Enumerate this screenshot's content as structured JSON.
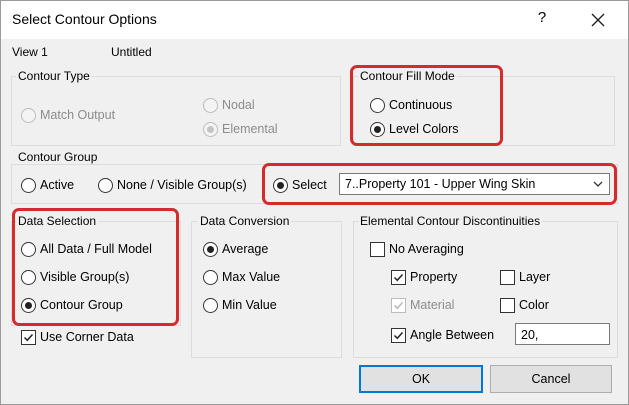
{
  "window": {
    "title": "Select Contour Options",
    "help_glyph": "?",
    "close_icon": "close-icon"
  },
  "view": {
    "name": "View 1",
    "title": "Untitled"
  },
  "contour_type": {
    "label": "Contour Type",
    "options": [
      "Match Output",
      "Nodal",
      "Elemental"
    ]
  },
  "contour_fill_mode": {
    "label": "Contour Fill Mode",
    "options": [
      "Continuous",
      "Level Colors"
    ],
    "selected": "Level Colors"
  },
  "contour_group": {
    "label": "Contour Group",
    "options": [
      "Active",
      "None / Visible Group(s)",
      "Select"
    ],
    "selected": "Select",
    "dropdown_value": "7..Property 101 - Upper Wing Skin"
  },
  "data_selection": {
    "label": "Data Selection",
    "options": [
      "All Data / Full Model",
      "Visible Group(s)",
      "Contour Group"
    ],
    "selected": "Contour Group",
    "use_corner_data": "Use Corner Data"
  },
  "data_conversion": {
    "label": "Data Conversion",
    "options": [
      "Average",
      "Max Value",
      "Min Value"
    ],
    "selected": "Average"
  },
  "discontinuities": {
    "label": "Elemental Contour Discontinuities",
    "no_averaging": "No Averaging",
    "property": "Property",
    "layer": "Layer",
    "material": "Material",
    "color": "Color",
    "angle_between": "Angle Between",
    "angle_value": "20,"
  },
  "buttons": {
    "ok": "OK",
    "cancel": "Cancel"
  },
  "colors": {
    "highlight": "#d42c2c",
    "focus": "#0078d7"
  }
}
